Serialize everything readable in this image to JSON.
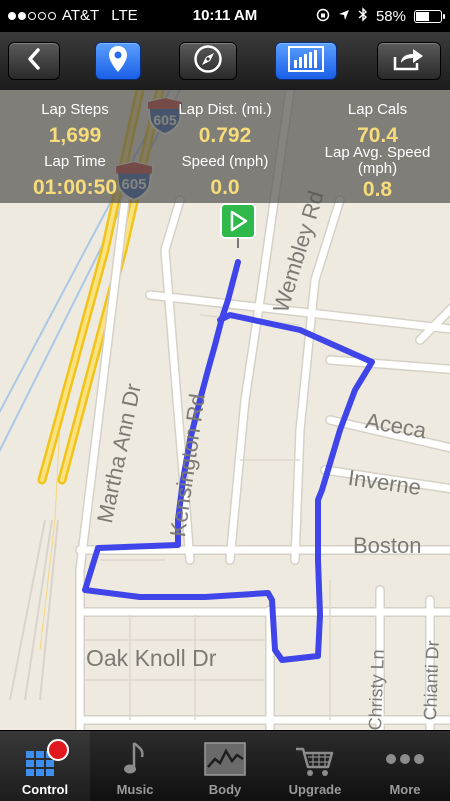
{
  "status": {
    "carrier": "AT&T",
    "network": "LTE",
    "time": "10:11 AM",
    "battery": "58%",
    "signal_bars": 2,
    "battery_level": 0.58
  },
  "toolbar": {
    "buttons": [
      {
        "name": "back",
        "icon": "chevron-left-icon"
      },
      {
        "name": "map",
        "icon": "location-pin-icon",
        "active": true
      },
      {
        "name": "compass",
        "icon": "compass-icon",
        "active": false
      },
      {
        "name": "stats",
        "icon": "bar-chart-icon",
        "active": true
      },
      {
        "name": "share",
        "icon": "share-icon",
        "active": false
      }
    ]
  },
  "stats": {
    "lap_steps_label": "Lap Steps",
    "lap_steps": "1,699",
    "lap_dist_label": "Lap Dist. (mi.)",
    "lap_dist": "0.792",
    "lap_cals_label": "Lap Cals",
    "lap_cals": "70.4",
    "lap_time_label": "Lap Time",
    "lap_time": "01:00:50",
    "speed_label": "Speed (mph)",
    "speed": "0.0",
    "lap_avg_speed_label": "Lap Avg. Speed (mph)",
    "lap_avg_speed": "0.8"
  },
  "map": {
    "highway_shield": "605",
    "streets": {
      "martha_ann": "Martha Ann Dr",
      "kensington": "Kensington Rd",
      "wembley": "Wembley Rd",
      "aceca": "Aceca",
      "inverness": "Inverne",
      "boston": "Boston",
      "oak_knoll": "Oak Knoll Dr",
      "christy": "Christy Ln",
      "chianti": "Chianti Dr"
    },
    "route_color": "#3f45e8"
  },
  "tabbar": {
    "tabs": [
      {
        "label": "Control",
        "icon": "grid-icon",
        "active": true
      },
      {
        "label": "Music",
        "icon": "music-note-icon",
        "active": false
      },
      {
        "label": "Body",
        "icon": "body-chart-icon",
        "active": false
      },
      {
        "label": "Upgrade",
        "icon": "cart-icon",
        "active": false
      },
      {
        "label": "More",
        "icon": "more-dots-icon",
        "active": false
      }
    ]
  }
}
